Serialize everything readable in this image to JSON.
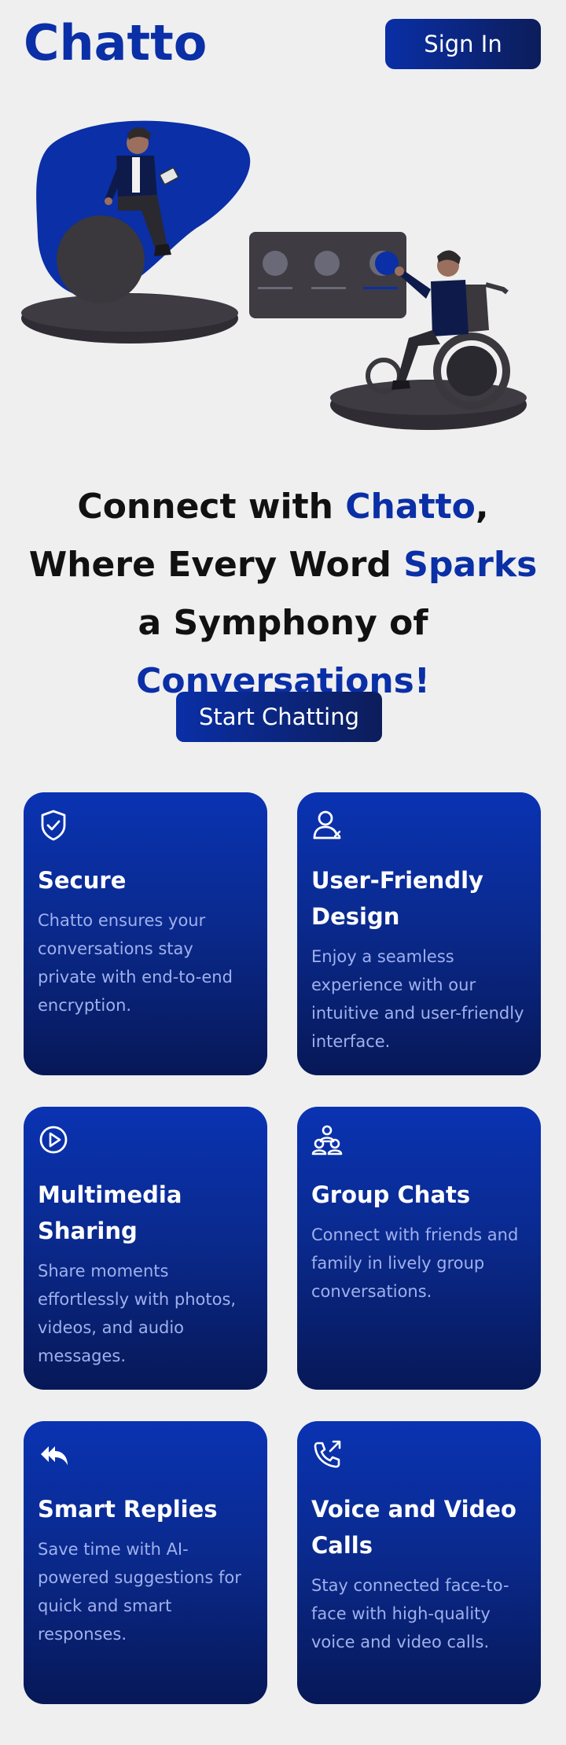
{
  "header": {
    "logo": "Chatto",
    "signin_label": "Sign In"
  },
  "hero": {
    "headline_parts": [
      "Connect with ",
      "Chatto",
      ", Where Every Word ",
      "Sparks",
      " a Symphony of ",
      "Conversations!"
    ],
    "cta_label": "Start Chatting"
  },
  "features": [
    {
      "icon": "shield-check-icon",
      "title": "Secure",
      "desc": "Chatto ensures your conversations stay private with end-to-end encryption."
    },
    {
      "icon": "user-icon",
      "title": "User-Friendly Design",
      "desc": "Enjoy a seamless experience with our intuitive and user-friendly interface."
    },
    {
      "icon": "play-circle-icon",
      "title": "Multimedia Sharing",
      "desc": "Share moments effortlessly with photos, videos, and audio messages."
    },
    {
      "icon": "group-icon",
      "title": "Group Chats",
      "desc": "Connect with friends and family in lively group conversations."
    },
    {
      "icon": "reply-all-icon",
      "title": "Smart Replies",
      "desc": "Save time with AI-powered suggestions for quick and smart responses."
    },
    {
      "icon": "phone-call-icon",
      "title": "Voice and Video Calls",
      "desc": "Stay connected face-to-face with high-quality voice and video calls."
    }
  ],
  "colors": {
    "brand": "#0a2fa6",
    "brand_dark": "#0c1d5a",
    "background": "#efeff0",
    "card_text_muted": "#9fb0ec"
  }
}
